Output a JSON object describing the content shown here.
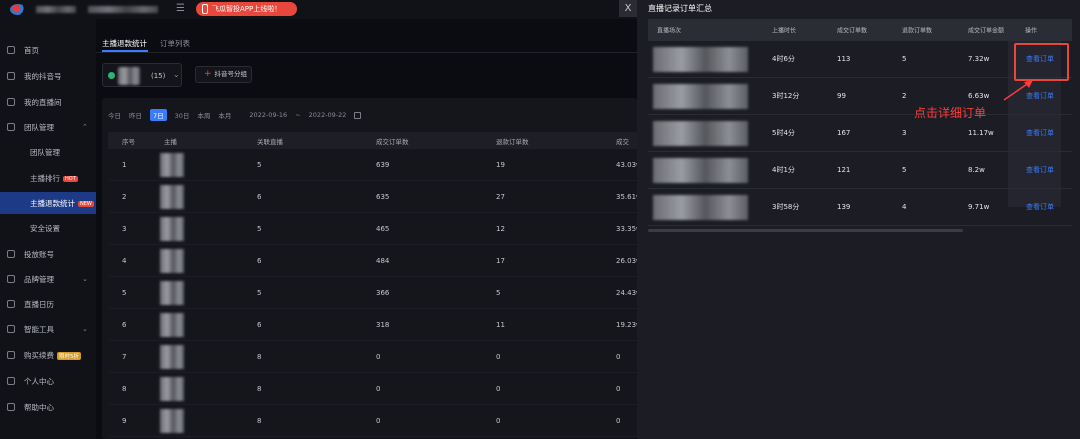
{
  "topbar": {
    "promo_label": "飞瓜智投APP上线啦！",
    "menu_icon": "menu-icon"
  },
  "sidebar": {
    "items": [
      {
        "label": "首页"
      },
      {
        "label": "我的抖音号"
      },
      {
        "label": "我的直播间"
      },
      {
        "label": "团队管理"
      },
      {
        "label": "团队管理"
      },
      {
        "label": "主播排行",
        "badge": "HOT"
      },
      {
        "label": "主播退款统计",
        "badge": "NEW"
      },
      {
        "label": "安全设置"
      },
      {
        "label": "投放账号"
      },
      {
        "label": "品牌管理"
      },
      {
        "label": "直播日历"
      },
      {
        "label": "智能工具"
      },
      {
        "label": "购买续费",
        "badge": "限时5折"
      },
      {
        "label": "个人中心"
      },
      {
        "label": "帮助中心"
      }
    ]
  },
  "main": {
    "tabs": [
      {
        "label": "主播退款统计"
      },
      {
        "label": "订单列表"
      }
    ],
    "account_count": "(15)",
    "group_button": "抖音号分组",
    "filters": {
      "today": "今日",
      "yesterday": "昨日",
      "d7": "7日",
      "d30": "30日",
      "week": "本周",
      "month": "本月",
      "date_start": "2022-09-16",
      "date_sep": "~",
      "date_end": "2022-09-22"
    },
    "table": {
      "columns": [
        "序号",
        "主播",
        "关联直播",
        "成交订单数",
        "退款订单数",
        "成交"
      ],
      "rows": [
        [
          "1",
          "5",
          "639",
          "19",
          "43.03w"
        ],
        [
          "2",
          "6",
          "635",
          "27",
          "35.61w"
        ],
        [
          "3",
          "5",
          "465",
          "12",
          "33.35w"
        ],
        [
          "4",
          "6",
          "484",
          "17",
          "26.03w"
        ],
        [
          "5",
          "5",
          "366",
          "5",
          "24.43w"
        ],
        [
          "6",
          "6",
          "318",
          "11",
          "19.23w"
        ],
        [
          "7",
          "8",
          "0",
          "0",
          "0"
        ],
        [
          "8",
          "8",
          "0",
          "0",
          "0"
        ],
        [
          "9",
          "8",
          "0",
          "0",
          "0"
        ]
      ]
    }
  },
  "drawer": {
    "title": "直播记录订单汇总",
    "close": "X",
    "columns": [
      "直播场次",
      "上播时长",
      "成交订单数",
      "退款订单数",
      "成交订单金额",
      "操作"
    ],
    "rows": [
      [
        "4时6分",
        "113",
        "5",
        "7.32w",
        "查看订单"
      ],
      [
        "3时12分",
        "99",
        "2",
        "6.63w",
        "查看订单"
      ],
      [
        "5时4分",
        "167",
        "3",
        "11.17w",
        "查看订单"
      ],
      [
        "4时1分",
        "121",
        "5",
        "8.2w",
        "查看订单"
      ],
      [
        "3时58分",
        "139",
        "4",
        "9.71w",
        "查看订单"
      ]
    ]
  },
  "annotation": {
    "text": "点击详细订单",
    "color": "#ff3b3b"
  },
  "colors": {
    "accent": "#3b7cff",
    "danger": "#e8473b",
    "success": "#2bb673"
  }
}
